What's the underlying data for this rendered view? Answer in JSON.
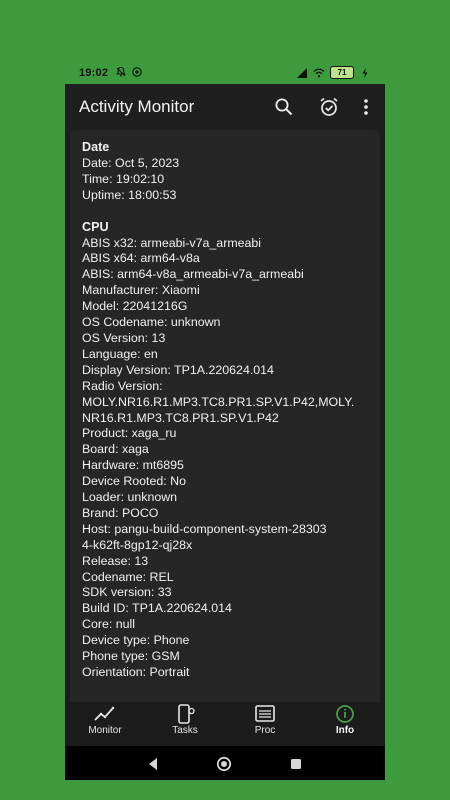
{
  "status": {
    "time": "19:02",
    "battery": "71"
  },
  "app_bar": {
    "title": "Activity Monitor",
    "icons": [
      "search-icon",
      "alarm-icon",
      "more-vert-icon"
    ]
  },
  "info": {
    "sections": [
      {
        "title": "Date",
        "lines": [
          "Date: Oct 5, 2023",
          "Time: 19:02:10",
          "Uptime: 18:00:53"
        ]
      },
      {
        "title": "CPU",
        "lines": [
          "ABIS x32: armeabi-v7a_armeabi",
          "ABIS x64: arm64-v8a",
          "ABIS: arm64-v8a_armeabi-v7a_armeabi",
          "Manufacturer: Xiaomi",
          "Model: 22041216G",
          "OS Codename: unknown",
          "OS Version: 13",
          "Language: en",
          "Display Version: TP1A.220624.014",
          "Radio Version:",
          "MOLY.NR16.R1.MP3.TC8.PR1.SP.V1.P42,MOLY.",
          "NR16.R1.MP3.TC8.PR1.SP.V1.P42",
          "Product: xaga_ru",
          "Board: xaga",
          "Hardware: mt6895",
          "Device Rooted: No",
          "Loader: unknown",
          "Brand: POCO",
          "Host: pangu-build-component-system-28303",
          "4-k62ft-8gp12-qj28x",
          "Release: 13",
          "Codename: REL",
          "SDK version: 33",
          "Build ID: TP1A.220624.014",
          "Core: null",
          "Device type: Phone",
          "Phone type: GSM",
          "Orientation: Portrait"
        ]
      }
    ]
  },
  "bottom_nav": {
    "items": [
      {
        "label": "Monitor",
        "icon": "chart-line-icon",
        "active": false
      },
      {
        "label": "Tasks",
        "icon": "phone-settings-icon",
        "active": false
      },
      {
        "label": "Proc",
        "icon": "list-window-icon",
        "active": false
      },
      {
        "label": "Info",
        "icon": "info-icon",
        "active": true
      }
    ]
  },
  "colors": {
    "background": "#3d9a3d",
    "surface": "#262626",
    "accent": "#43a047"
  }
}
